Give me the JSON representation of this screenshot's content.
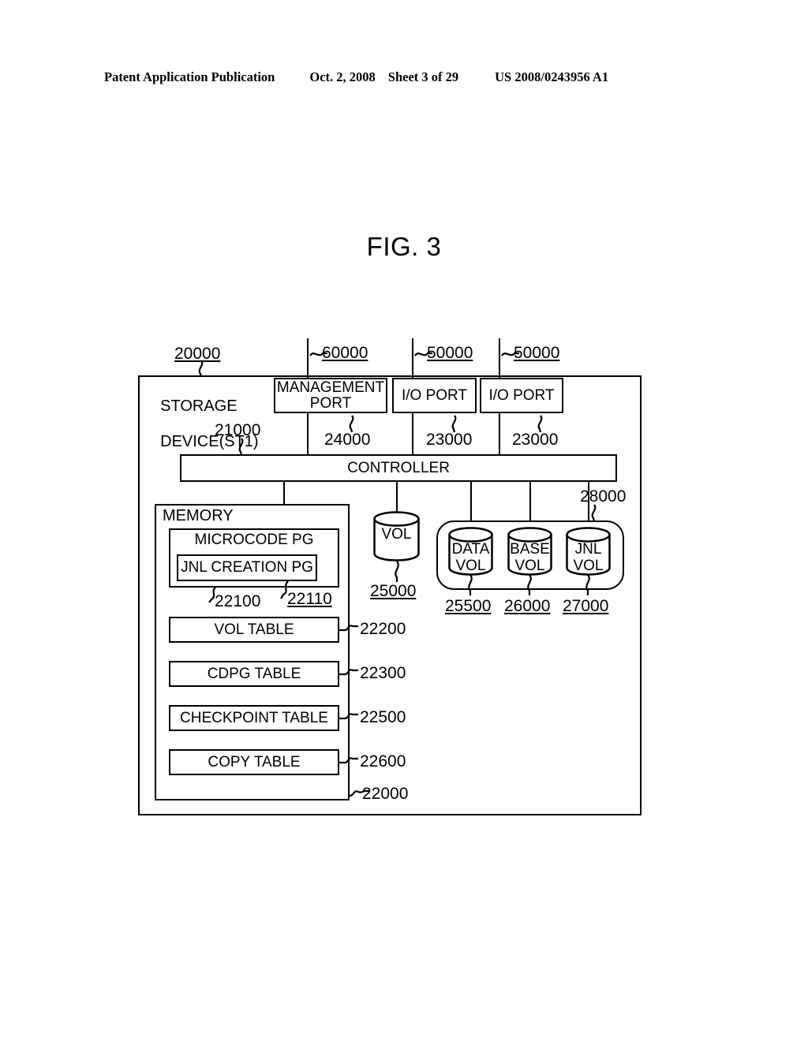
{
  "header": {
    "left": "Patent Application Publication",
    "date": "Oct. 2, 2008",
    "sheet": "Sheet 3 of 29",
    "patent_number": "US 2008/0243956 A1"
  },
  "figure": {
    "title": "FIG. 3"
  },
  "diagram": {
    "storage_device": {
      "label_line1": "STORAGE",
      "label_line2": "DEVICE(ST1)",
      "ref": "20000"
    },
    "ports": [
      {
        "name": "management-port",
        "label_line1": "MANAGEMENT",
        "label_line2": "PORT",
        "ref_top": "60000",
        "ref_bottom": "24000"
      },
      {
        "name": "io-port-1",
        "label_line1": "I/O PORT",
        "label_line2": "",
        "ref_top": "50000",
        "ref_bottom": "23000"
      },
      {
        "name": "io-port-2",
        "label_line1": "I/O PORT",
        "label_line2": "",
        "ref_top": "50000",
        "ref_bottom": "23000"
      }
    ],
    "controller": {
      "label": "CONTROLLER",
      "ref": "21000"
    },
    "memory": {
      "label": "MEMORY",
      "ref": "22000",
      "microcode": {
        "label": "MICROCODE PG",
        "ref": "22100"
      },
      "jnl_creation": {
        "label": "JNL CREATION PG",
        "ref": "22110"
      },
      "tables": [
        {
          "label": "VOL TABLE",
          "ref": "22200"
        },
        {
          "label": "CDPG TABLE",
          "ref": "22300"
        },
        {
          "label": "CHECKPOINT TABLE",
          "ref": "22500"
        },
        {
          "label": "COPY TABLE",
          "ref": "22600"
        }
      ]
    },
    "standalone_volume": {
      "label": "VOL",
      "ref": "25000"
    },
    "volume_group": {
      "ref": "28000",
      "volumes": [
        {
          "label_line1": "DATA",
          "label_line2": "VOL",
          "ref": "25500"
        },
        {
          "label_line1": "BASE",
          "label_line2": "VOL",
          "ref": "26000"
        },
        {
          "label_line1": "JNL",
          "label_line2": "VOL",
          "ref": "27000"
        }
      ]
    }
  }
}
